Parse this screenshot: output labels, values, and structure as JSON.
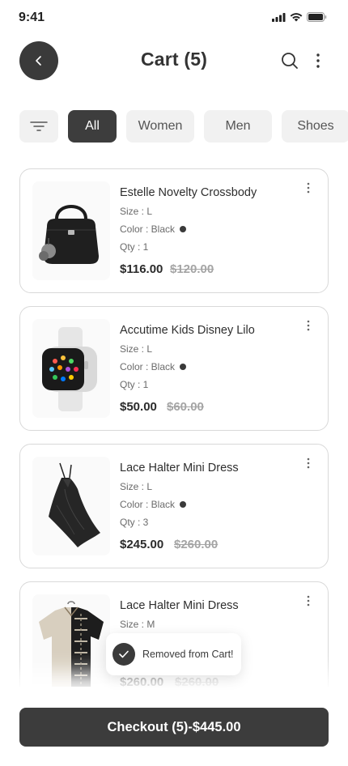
{
  "status_bar": {
    "time": "9:41"
  },
  "header": {
    "title": "Cart (5)",
    "back_icon": "chevron-left-icon",
    "search_icon": "search-icon",
    "more_icon": "more-vertical-icon"
  },
  "filters": {
    "filter_icon": "filter-icon",
    "chips": [
      {
        "label": "All",
        "active": true
      },
      {
        "label": "Women",
        "active": false
      },
      {
        "label": "Men",
        "active": false
      },
      {
        "label": "Shoes",
        "active": false
      }
    ]
  },
  "cart": {
    "items": [
      {
        "name": "Estelle Novelty Crossbody",
        "size": "Size : L",
        "color": "Color : Black",
        "qty": "Qty : 1",
        "price": "$116.00",
        "old_price": "$120.00",
        "image": "black-handbag"
      },
      {
        "name": "Accutime Kids Disney Lilo",
        "size": "Size : L",
        "color": "Color : Black",
        "qty": "Qty : 1",
        "price": "$50.00",
        "old_price": "$60.00",
        "image": "white-smartwatch"
      },
      {
        "name": "Lace Halter Mini Dress",
        "size": "Size : L",
        "color": "Color : Black",
        "qty": "Qty : 3",
        "price": "$245.00",
        "old_price": "$260.00",
        "image": "black-halter-dress"
      },
      {
        "name": "Lace Halter Mini Dress",
        "size": "Size : M",
        "price": "$260.00",
        "old_price": "$260.00",
        "image": "patterned-shirt"
      }
    ]
  },
  "toast": {
    "message": "Removed from Cart!"
  },
  "checkout": {
    "label": "Checkout (5)-$445.00"
  },
  "colors": {
    "primary": "#3c3c3c",
    "chip_bg": "#f1f1f1",
    "border": "#d9d9d9",
    "muted": "#a5a5a5"
  }
}
